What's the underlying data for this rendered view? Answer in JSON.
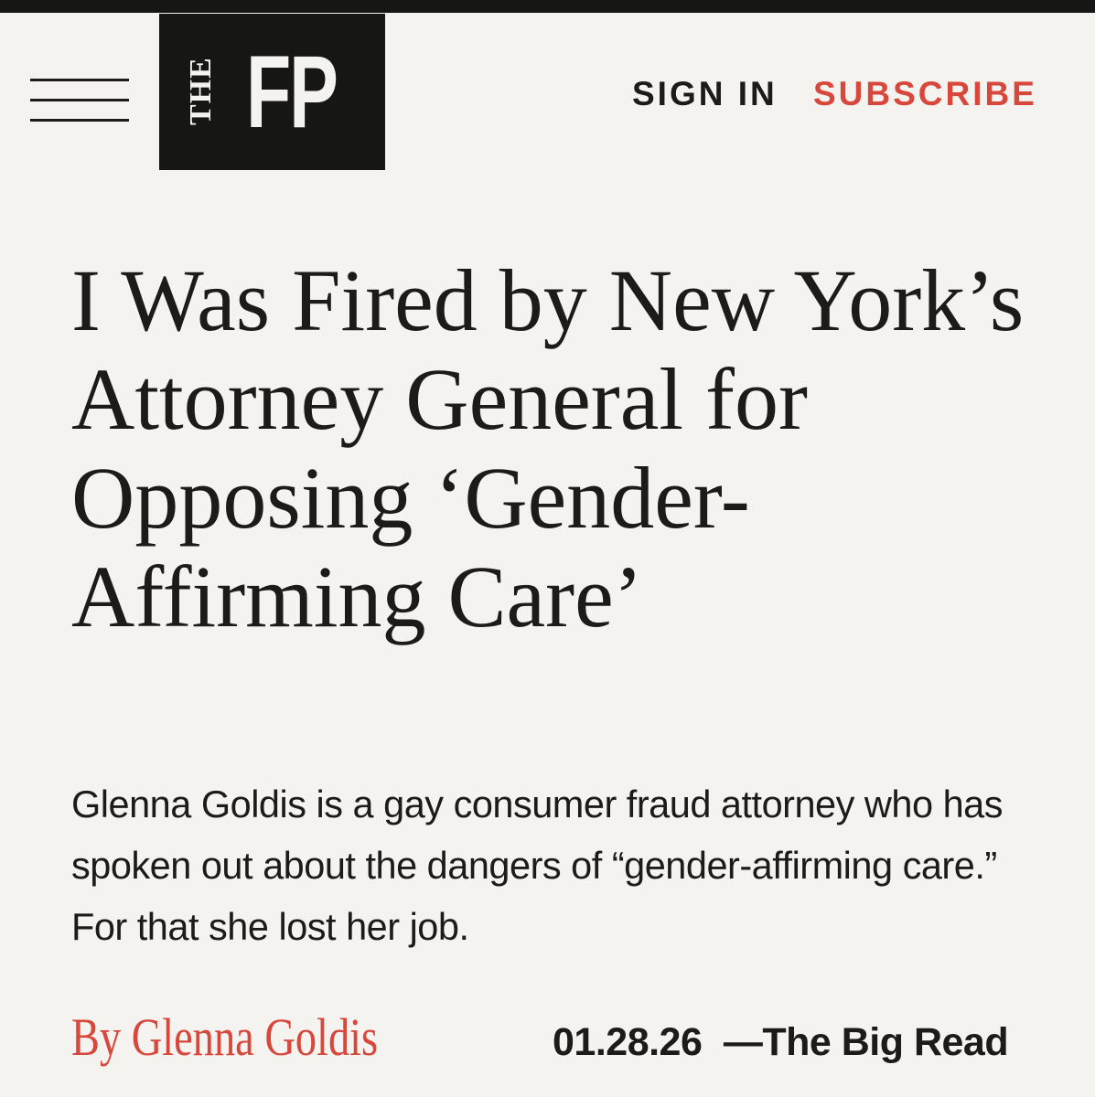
{
  "header": {
    "logo_small": "THE",
    "logo_large": "FP",
    "sign_in_label": "SIGN IN",
    "subscribe_label": "SUBSCRIBE",
    "menu_icon": "hamburger-menu-icon"
  },
  "article": {
    "headline": "I Was Fired by New York’s Attorney General for Opposing ‘Gender-Affirming Care’",
    "dek": "Glenna Goldis is a gay consumer fraud attorney who has spoken out about the dangers of “gender-affirming care.” For that she lost her job.",
    "byline": "By Glenna Goldis",
    "date": "01.28.26",
    "separator": "—",
    "section": "The Big Read"
  },
  "colors": {
    "background": "#f4f3ef",
    "text": "#1c1b19",
    "accent": "#d8473b",
    "logo_bg": "#161614"
  }
}
